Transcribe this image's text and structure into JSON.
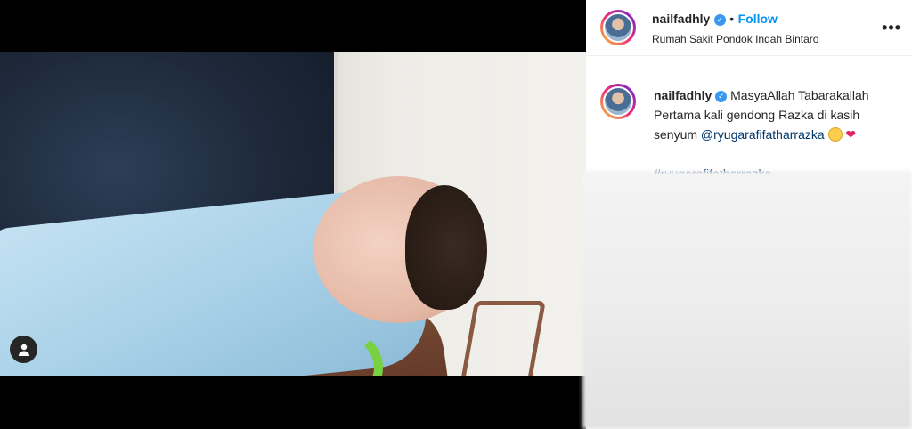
{
  "post": {
    "username": "nailfadhly",
    "separator": "•",
    "follow_label": "Follow",
    "location": "Rumah Sakit Pondok Indah Bintaro",
    "more_label": "•••"
  },
  "caption": {
    "username": "nailfadhly",
    "line1": "MasyaAllah Tabarakallah",
    "line2_pre": "Pertama kali gendong Razka di kasih",
    "line3_pre": "senyum ",
    "mention": "@ryugarafifatharrazka",
    "hashtag": "#ryugarafifatharrazka",
    "heart": "❤"
  },
  "icons": {
    "verified": "verified-badge-icon",
    "user_tag": "user-tag-icon",
    "more": "more-options-icon"
  },
  "colors": {
    "accent": "#0095f6",
    "verified": "#3897f0",
    "link": "#00376b"
  }
}
